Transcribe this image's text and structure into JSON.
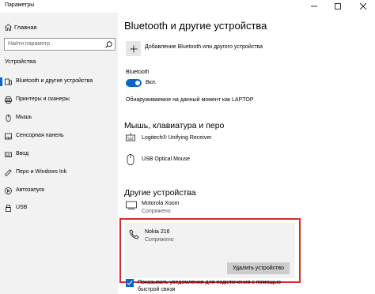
{
  "window": {
    "title": "Параметры",
    "minimize_glyph": "—",
    "maximize_glyph": "☐",
    "close_glyph": "✕"
  },
  "sidebar": {
    "home_label": "Главная",
    "search_placeholder": "Найти параметр",
    "section_label": "Устройства",
    "items": [
      {
        "label": "Bluetooth и другие устройства",
        "icon": "bluetooth-devices-icon",
        "active": true
      },
      {
        "label": "Принтеры и сканеры",
        "icon": "printer-icon",
        "active": false
      },
      {
        "label": "Мышь",
        "icon": "mouse-icon",
        "active": false
      },
      {
        "label": "Сенсорная панель",
        "icon": "touchpad-icon",
        "active": false
      },
      {
        "label": "Ввод",
        "icon": "keyboard-icon",
        "active": false
      },
      {
        "label": "Перо и Windows Ink",
        "icon": "pen-icon",
        "active": false
      },
      {
        "label": "Автозапуск",
        "icon": "autoplay-icon",
        "active": false
      },
      {
        "label": "USB",
        "icon": "usb-icon",
        "active": false
      }
    ]
  },
  "main": {
    "title": "Bluetooth и другие устройства",
    "add_label": "Добавление Bluetooth или другого устройства",
    "bluetooth_label": "Bluetooth",
    "toggle_state": "Вкл.",
    "toggle_on": true,
    "discoverable_text": "Обнаруживаемое на данный момент как  LAPTOP",
    "section_mouse": "Мышь, клавиатура и перо",
    "mouse_devices": [
      {
        "name": "Logitech® Unifying Receiver",
        "icon": "keyboard-device-icon"
      },
      {
        "name": "USB Optical Mouse",
        "icon": "mouse-device-icon"
      }
    ],
    "section_other": "Другие устройства",
    "other_devices": [
      {
        "name": "Motorola Xoom",
        "status": "Сопряжено",
        "icon": "tablet-device-icon"
      }
    ],
    "selected_device": {
      "name": "Nokia 216",
      "status": "Сопряжено",
      "icon": "phone-icon",
      "remove_label": "Удалить устройство"
    },
    "notify_checkbox": {
      "checked": true,
      "label": "Показывать уведомления для подключения с помощью быстрой связи"
    }
  },
  "colors": {
    "accent": "#0a64c2",
    "highlight_border": "#d42c2c",
    "sidebar_bg": "#f2f2f2"
  }
}
